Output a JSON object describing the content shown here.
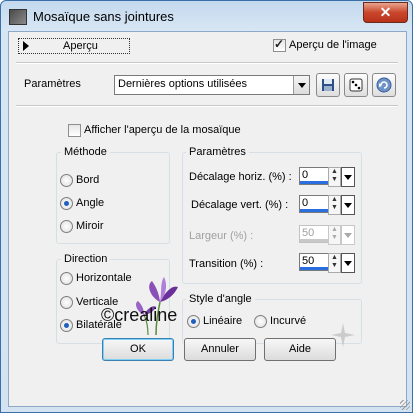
{
  "window": {
    "title": "Mosaïque sans jointures",
    "close_label": "✕"
  },
  "preview": {
    "toggle_label": "Aperçu",
    "image_preview_label": "Aperçu de l'image",
    "image_preview_checked": true
  },
  "presets": {
    "label": "Paramètres",
    "value": "Dernières options utilisées"
  },
  "tile_preview": {
    "label": "Afficher l'aperçu de la mosaïque",
    "checked": false
  },
  "method": {
    "title": "Méthode",
    "options": [
      {
        "label": "Bord",
        "selected": false
      },
      {
        "label": "Angle",
        "selected": true
      },
      {
        "label": "Miroir",
        "selected": false
      }
    ]
  },
  "params": {
    "title": "Paramètres",
    "fields": [
      {
        "label": "Décalage horiz. (%) :",
        "value": "0",
        "enabled": true
      },
      {
        "label": "Décalage vert. (%) :",
        "value": "0",
        "enabled": true
      },
      {
        "label": "Largeur (%) :",
        "value": "50",
        "enabled": false
      },
      {
        "label": "Transition (%) :",
        "value": "50",
        "enabled": true
      }
    ]
  },
  "direction": {
    "title": "Direction",
    "options": [
      {
        "label": "Horizontale",
        "selected": false
      },
      {
        "label": "Verticale",
        "selected": false
      },
      {
        "label": "Bilatérale",
        "selected": true
      }
    ]
  },
  "corner_style": {
    "title": "Style d'angle",
    "options": [
      {
        "label": "Linéaire",
        "selected": true
      },
      {
        "label": "Incurvé",
        "selected": false
      }
    ]
  },
  "buttons": {
    "ok": "OK",
    "cancel": "Annuler",
    "help": "Aide"
  },
  "watermark": {
    "text": "©crealine"
  },
  "colors": {
    "accent": "#2a6ee0",
    "title_bar": "#c4d9ee",
    "close": "#c9462b"
  }
}
